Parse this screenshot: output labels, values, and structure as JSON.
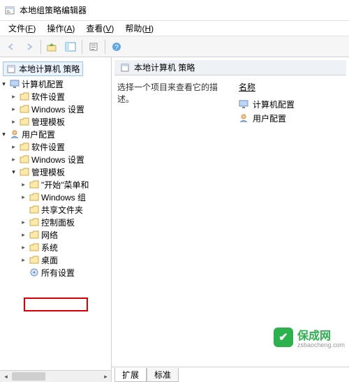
{
  "titlebar": {
    "title": "本地组策略编辑器"
  },
  "menubar": {
    "file": {
      "label": "文件",
      "mn": "F"
    },
    "action": {
      "label": "操作",
      "mn": "A"
    },
    "view": {
      "label": "查看",
      "mn": "V"
    },
    "help": {
      "label": "帮助",
      "mn": "H"
    }
  },
  "tree": {
    "root": "本地计算机 策略",
    "cc": "计算机配置",
    "cc_soft": "软件设置",
    "cc_win": "Windows 设置",
    "cc_tmpl": "管理模板",
    "uc": "用户配置",
    "uc_soft": "软件设置",
    "uc_win": "Windows 设置",
    "uc_tmpl": "管理模板",
    "start": "\"开始\"菜单和",
    "wincomp": "Windows 组",
    "shared": "共享文件夹",
    "ctrl": "控制面板",
    "net": "网络",
    "sys": "系统",
    "desktop": "桌面",
    "allset": "所有设置"
  },
  "detail": {
    "header": "本地计算机 策略",
    "desc": "选择一个项目来查看它的描述。",
    "col_name": "名称",
    "item_cc": "计算机配置",
    "item_uc": "用户配置"
  },
  "tabs": {
    "ext": "扩展",
    "std": "标准"
  },
  "watermark": {
    "name": "保成网",
    "url": "zsbaocheng.com"
  }
}
